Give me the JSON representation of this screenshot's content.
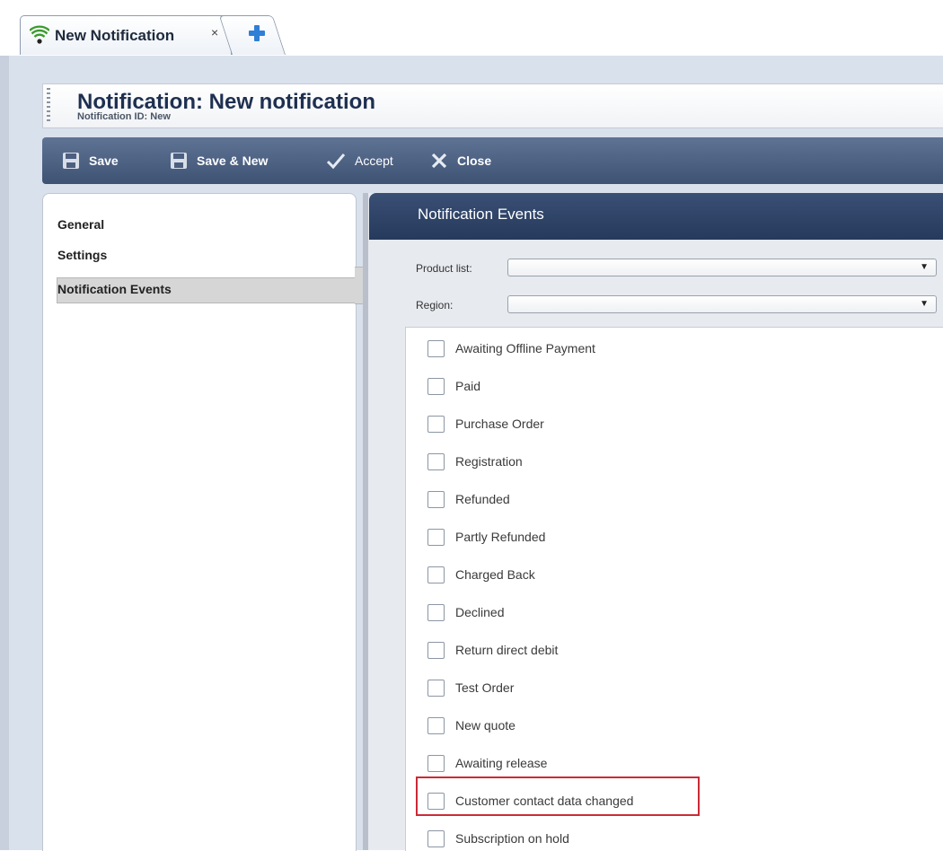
{
  "tabs": {
    "active_label": "New Notification",
    "close_glyph": "×",
    "add_icon": "plus-icon",
    "tab_icon": "wifi-icon"
  },
  "header": {
    "title": "Notification: New notification",
    "subtitle": "Notification ID: New"
  },
  "toolbar": {
    "save_label": "Save",
    "save_new_label": "Save & New",
    "accept_label": "Accept",
    "close_label": "Close"
  },
  "sidebar": {
    "items": [
      {
        "label": "General"
      },
      {
        "label": "Settings"
      },
      {
        "label": "Notification Events",
        "active": true
      }
    ]
  },
  "main": {
    "title": "Notification Events",
    "product_list_label": "Product list:",
    "product_list_value": "",
    "region_label": "Region:",
    "region_value": "",
    "events": [
      {
        "label": "Awaiting Offline Payment",
        "checked": false
      },
      {
        "label": "Paid",
        "checked": false
      },
      {
        "label": "Purchase Order",
        "checked": false
      },
      {
        "label": "Registration",
        "checked": false
      },
      {
        "label": "Refunded",
        "checked": false
      },
      {
        "label": "Partly Refunded",
        "checked": false
      },
      {
        "label": "Charged Back",
        "checked": false
      },
      {
        "label": "Declined",
        "checked": false
      },
      {
        "label": "Return direct debit",
        "checked": false
      },
      {
        "label": "Test Order",
        "checked": false
      },
      {
        "label": "New quote",
        "checked": false
      },
      {
        "label": "Awaiting release",
        "checked": false
      },
      {
        "label": "Customer contact data changed",
        "checked": false,
        "highlighted": true
      },
      {
        "label": "Subscription on hold",
        "checked": false
      }
    ]
  },
  "colors": {
    "toolbar": "#4e6286",
    "panel_header": "#2e4367",
    "highlight": "#cc2a36",
    "active_nav": "#d6d6d6"
  }
}
